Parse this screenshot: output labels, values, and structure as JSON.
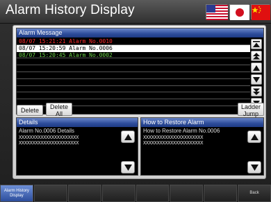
{
  "window": {
    "title": "Alarm History Display"
  },
  "flags": [
    {
      "icon": "flag-usa"
    },
    {
      "icon": "flag-japan"
    },
    {
      "icon": "flag-china"
    }
  ],
  "alarm_list": {
    "header": "Alarm Message",
    "rows": [
      {
        "text": "08/07 15:21:21 Alarm No.0010",
        "color": "#ff2a2a",
        "selected": false
      },
      {
        "text": "08/07 15:20:59 Alarm No.0006",
        "color": "#000000",
        "selected": true
      },
      {
        "text": "08/07 15:20:45 Alarm No.0002",
        "color": "#6cd04a",
        "selected": false
      }
    ]
  },
  "buttons": {
    "delete": "Delete",
    "delete_all_line1": "Delete",
    "delete_all_line2": "All",
    "ladder_line1": "Ladder",
    "ladder_line2": "Jump"
  },
  "details": {
    "header": "Details",
    "line1": "Alarm No.0006 Details",
    "line2": "XXXXXXXXXXXXXXXXXXXXXX",
    "line3": "XXXXXXXXXXXXXXXXXXXXXX"
  },
  "restore": {
    "header": "How to Restore Alarm",
    "line1": "How to Restore Alarm No.0006",
    "line2": "XXXXXXXXXXXXXXXXXXXXXX",
    "line3": "XXXXXXXXXXXXXXXXXXXXXX"
  },
  "function_keys": [
    {
      "label_line1": "Alarm History",
      "label_line2": "Display",
      "active": true
    },
    {
      "label_line1": "",
      "label_line2": "",
      "active": false
    },
    {
      "label_line1": "",
      "label_line2": "",
      "active": false
    },
    {
      "label_line1": "",
      "label_line2": "",
      "active": false
    },
    {
      "label_line1": "",
      "label_line2": "",
      "active": false
    },
    {
      "label_line1": "",
      "label_line2": "",
      "active": false
    },
    {
      "label_line1": "",
      "label_line2": "",
      "active": false
    },
    {
      "label_line1": "Back",
      "label_line2": "",
      "active": false
    }
  ]
}
